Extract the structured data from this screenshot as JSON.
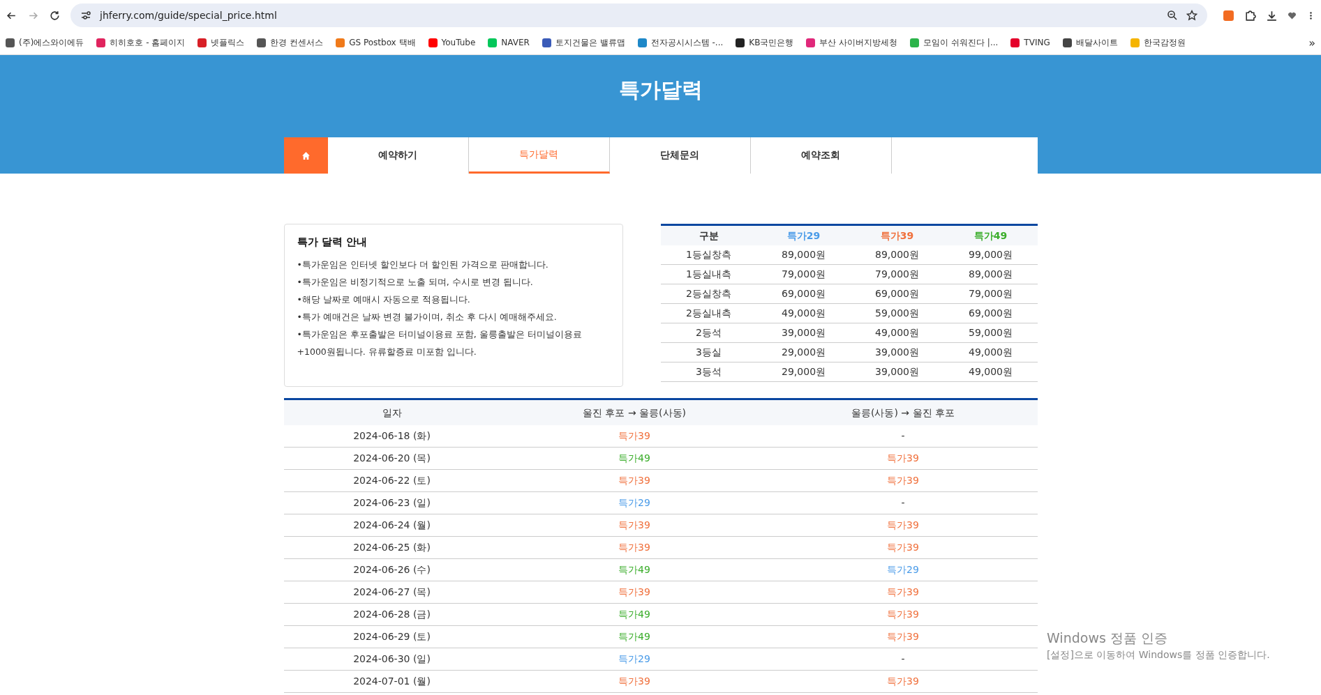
{
  "browser": {
    "url": "jhferry.com/guide/special_price.html",
    "bookmarks": [
      "(주)에스와이에듀",
      "히히호호 - 홈페이지",
      "넷플릭스",
      "한경 컨센서스",
      "GS Postbox 택배",
      "YouTube",
      "NAVER",
      "토지건물은 밸류맵",
      "전자공시시스템 -...",
      "KB국민은행",
      "부산 사이버지방세청",
      "모임이 쉬워진다 |...",
      "TVING",
      "배달사이트",
      "한국감정원"
    ],
    "bookmarks_more": "»"
  },
  "header": {
    "title": "특가달력"
  },
  "nav": {
    "tabs": [
      {
        "label": "예약하기",
        "selected": false
      },
      {
        "label": "특가달력",
        "selected": true
      },
      {
        "label": "단체문의",
        "selected": false
      },
      {
        "label": "예약조회",
        "selected": false
      }
    ]
  },
  "info": {
    "title": "특가 달력 안내",
    "lines": [
      "•특가운임은 인터넷 할인보다 더 할인된 가격으로 판매합니다.",
      "•특가운임은 비정기적으로 노출 되며, 수시로 변경 됩니다.",
      "•해당 날짜로 예매시 자동으로 적용됩니다.",
      "•특가 예매건은 날짜 변경 불가이며, 취소 후 다시 예매해주세요.",
      "•특가운임은 후포출발은 터미널이용료 포함, 울릉출발은 터미널이용료 +1000원됩니다. 유류할증료 미포함 입니다."
    ]
  },
  "price_table": {
    "columns": [
      {
        "label": "구분",
        "color": "#333333"
      },
      {
        "label": "특가29",
        "color": "#4a9be8"
      },
      {
        "label": "특가39",
        "color": "#f0703c"
      },
      {
        "label": "특가49",
        "color": "#3aad2a"
      }
    ],
    "rows": [
      [
        "1등실창측",
        "89,000원",
        "89,000원",
        "99,000원"
      ],
      [
        "1등실내측",
        "79,000원",
        "79,000원",
        "89,000원"
      ],
      [
        "2등실창측",
        "69,000원",
        "69,000원",
        "79,000원"
      ],
      [
        "2등실내측",
        "49,000원",
        "59,000원",
        "69,000원"
      ],
      [
        "2등석",
        "39,000원",
        "49,000원",
        "59,000원"
      ],
      [
        "3등실",
        "29,000원",
        "39,000원",
        "49,000원"
      ],
      [
        "3등석",
        "29,000원",
        "39,000원",
        "49,000원"
      ]
    ]
  },
  "schedule": {
    "columns": [
      "일자",
      "울진 후포 → 울릉(사동)",
      "울릉(사동) → 울진 후포"
    ],
    "rows": [
      {
        "date": "2024-06-18 (화)",
        "out": {
          "label": "특가39",
          "color": "#f0703c"
        },
        "back": {
          "label": "-"
        }
      },
      {
        "date": "2024-06-20 (목)",
        "out": {
          "label": "특가49",
          "color": "#3aad2a"
        },
        "back": {
          "label": "특가39",
          "color": "#f0703c"
        }
      },
      {
        "date": "2024-06-22 (토)",
        "out": {
          "label": "특가39",
          "color": "#f0703c"
        },
        "back": {
          "label": "특가39",
          "color": "#f0703c"
        }
      },
      {
        "date": "2024-06-23 (일)",
        "out": {
          "label": "특가29",
          "color": "#4a9be8"
        },
        "back": {
          "label": "-"
        }
      },
      {
        "date": "2024-06-24 (월)",
        "out": {
          "label": "특가39",
          "color": "#f0703c"
        },
        "back": {
          "label": "특가39",
          "color": "#f0703c"
        }
      },
      {
        "date": "2024-06-25 (화)",
        "out": {
          "label": "특가39",
          "color": "#f0703c"
        },
        "back": {
          "label": "특가39",
          "color": "#f0703c"
        }
      },
      {
        "date": "2024-06-26 (수)",
        "out": {
          "label": "특가49",
          "color": "#3aad2a"
        },
        "back": {
          "label": "특가29",
          "color": "#4a9be8"
        }
      },
      {
        "date": "2024-06-27 (목)",
        "out": {
          "label": "특가39",
          "color": "#f0703c"
        },
        "back": {
          "label": "특가39",
          "color": "#f0703c"
        }
      },
      {
        "date": "2024-06-28 (금)",
        "out": {
          "label": "특가49",
          "color": "#3aad2a"
        },
        "back": {
          "label": "특가39",
          "color": "#f0703c"
        }
      },
      {
        "date": "2024-06-29 (토)",
        "out": {
          "label": "특가49",
          "color": "#3aad2a"
        },
        "back": {
          "label": "특가39",
          "color": "#f0703c"
        }
      },
      {
        "date": "2024-06-30 (일)",
        "out": {
          "label": "특가29",
          "color": "#4a9be8"
        },
        "back": {
          "label": "-"
        }
      },
      {
        "date": "2024-07-01 (월)",
        "out": {
          "label": "특가39",
          "color": "#f0703c"
        },
        "back": {
          "label": "특가39",
          "color": "#f0703c"
        }
      }
    ]
  },
  "activation": {
    "title": "Windows 정품 인증",
    "text": "[설정]으로 이동하여 Windows를 정품 인증합니다."
  }
}
